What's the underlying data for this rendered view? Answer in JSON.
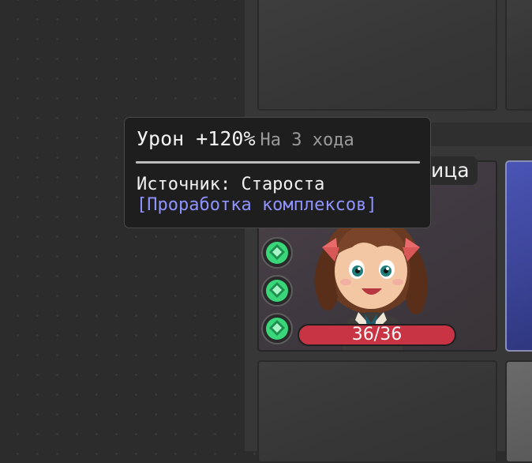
{
  "tooltip": {
    "effect": "Урон +120%",
    "duration": "На 3 хода",
    "source": "Источник: Староста",
    "ability_link": "[Проработка комплексов]"
  },
  "character_card": {
    "name_partial": "ица",
    "hp_text": "36/36",
    "hp_fraction": 1.0,
    "buff_icons": [
      "green-gem-icon",
      "green-gem-icon",
      "green-gem-icon"
    ]
  },
  "colors": {
    "hp_bar": "#c83444",
    "link": "#8f93ff",
    "buff_gem": "#39d67a",
    "blue_card": "#4a55b5"
  }
}
